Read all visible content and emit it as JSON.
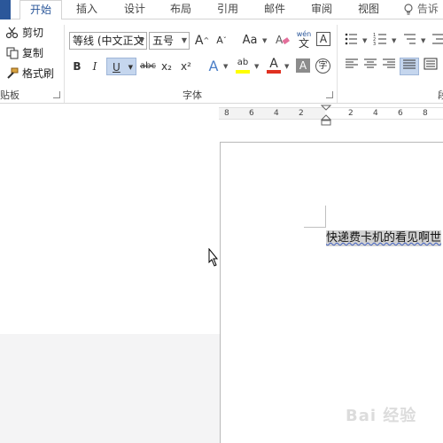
{
  "tabs": {
    "items": [
      {
        "label": "开始"
      },
      {
        "label": "插入"
      },
      {
        "label": "设计"
      },
      {
        "label": "布局"
      },
      {
        "label": "引用"
      },
      {
        "label": "邮件"
      },
      {
        "label": "审阅"
      },
      {
        "label": "视图"
      }
    ],
    "tell_me": "告诉"
  },
  "clipboard": {
    "cut_label": "剪切",
    "copy_label": "复制",
    "format_painter_label": "格式刷",
    "group_label": "贴板"
  },
  "font": {
    "name_value": "等线 (中文正文",
    "size_value": "五号",
    "grow_label": "A",
    "shrink_label": "A",
    "case_label": "Aa",
    "phonetic_top": "wén",
    "phonetic_bottom": "文",
    "border_char_label": "A",
    "bold_label": "B",
    "italic_label": "I",
    "underline_label": "U",
    "strike_label": "abc",
    "subscript_label": "x₂",
    "superscript_label": "x²",
    "effects_label": "A",
    "highlight_label": "ab",
    "font_color_label": "A",
    "shading_label": "A",
    "enclose_label": "字",
    "group_label": "字体"
  },
  "paragraph": {
    "group_label_partial": "段"
  },
  "ruler": {
    "ticks": [
      "8",
      "6",
      "4",
      "2",
      "2",
      "4",
      "6",
      "8"
    ]
  },
  "document": {
    "text": "快递费卡机的看见啊世"
  },
  "watermark": {
    "text": "Bai 经验"
  },
  "colors": {
    "accent": "#2b579a",
    "highlight": "#ffff00",
    "font_color": "#e03020",
    "selection": "#d2d2d2"
  }
}
